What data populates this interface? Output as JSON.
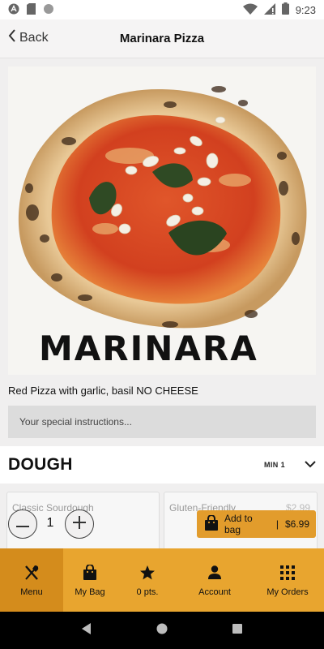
{
  "status_bar": {
    "time": "9:23",
    "icons": [
      "app-logo-icon",
      "sim-card-icon",
      "sync-dot-icon",
      "wifi-icon",
      "no-sim-icon",
      "battery-icon"
    ]
  },
  "header": {
    "back_label": "Back",
    "title": "Marinara Pizza"
  },
  "product": {
    "image_caption": "MARINARA",
    "description": "Red Pizza with garlic, basil NO CHEESE"
  },
  "instructions": {
    "placeholder": "Your special instructions...",
    "value": ""
  },
  "dough_section": {
    "title": "DOUGH",
    "min_label": "MIN 1",
    "options": [
      {
        "label": "Classic Sourdough",
        "price": ""
      },
      {
        "label": "Gluten-Friendly",
        "price": "$2.99"
      }
    ]
  },
  "cart": {
    "quantity": "1",
    "add_label": "Add to bag",
    "separator": "|",
    "price": "$6.99"
  },
  "bottom_nav": {
    "items": [
      {
        "label": "Menu",
        "icon": "fork-knife-icon",
        "active": true
      },
      {
        "label": "My Bag",
        "icon": "bag-icon",
        "active": false
      },
      {
        "label": "0 pts.",
        "icon": "star-icon",
        "active": false
      },
      {
        "label": "Account",
        "icon": "person-icon",
        "active": false
      },
      {
        "label": "My Orders",
        "icon": "grid-icon",
        "active": false
      }
    ]
  },
  "colors": {
    "accent": "#e8a52f",
    "accent_active": "#d48c1c",
    "add_button": "#e29c2c"
  }
}
